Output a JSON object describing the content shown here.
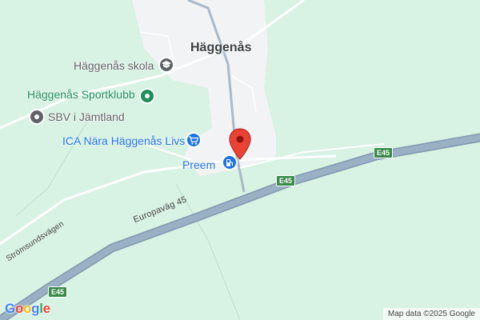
{
  "map": {
    "town_label": "Häggenås",
    "pois": [
      {
        "name": "Häggenås skola",
        "icon": "school-icon",
        "color": "#5f6368"
      },
      {
        "name": "Häggenås Sportklubb",
        "icon": "sports-club-icon",
        "color": "#1e8e5a"
      },
      {
        "name": "SBV i Jämtland",
        "icon": "place-icon",
        "color": "#5f6368"
      },
      {
        "name": "ICA Nära Häggenås Livs",
        "icon": "shopping-cart-icon",
        "color": "#1a73e8"
      },
      {
        "name": "Preem",
        "icon": "gas-station-icon",
        "color": "#1a73e8"
      }
    ],
    "roads": {
      "europavag": "Europaväg 45",
      "stromsund": "Strömsundsvägen",
      "shields": [
        "E45",
        "E45",
        "E45"
      ]
    },
    "marker": {
      "icon": "location-pin-icon",
      "color": "#ea4335"
    },
    "attribution": "Map data ©2025 Google",
    "logo": "Google",
    "colors": {
      "land": "#d8f2e3",
      "settlement": "#f1f3f4",
      "highway": "#8aa3b8"
    }
  }
}
